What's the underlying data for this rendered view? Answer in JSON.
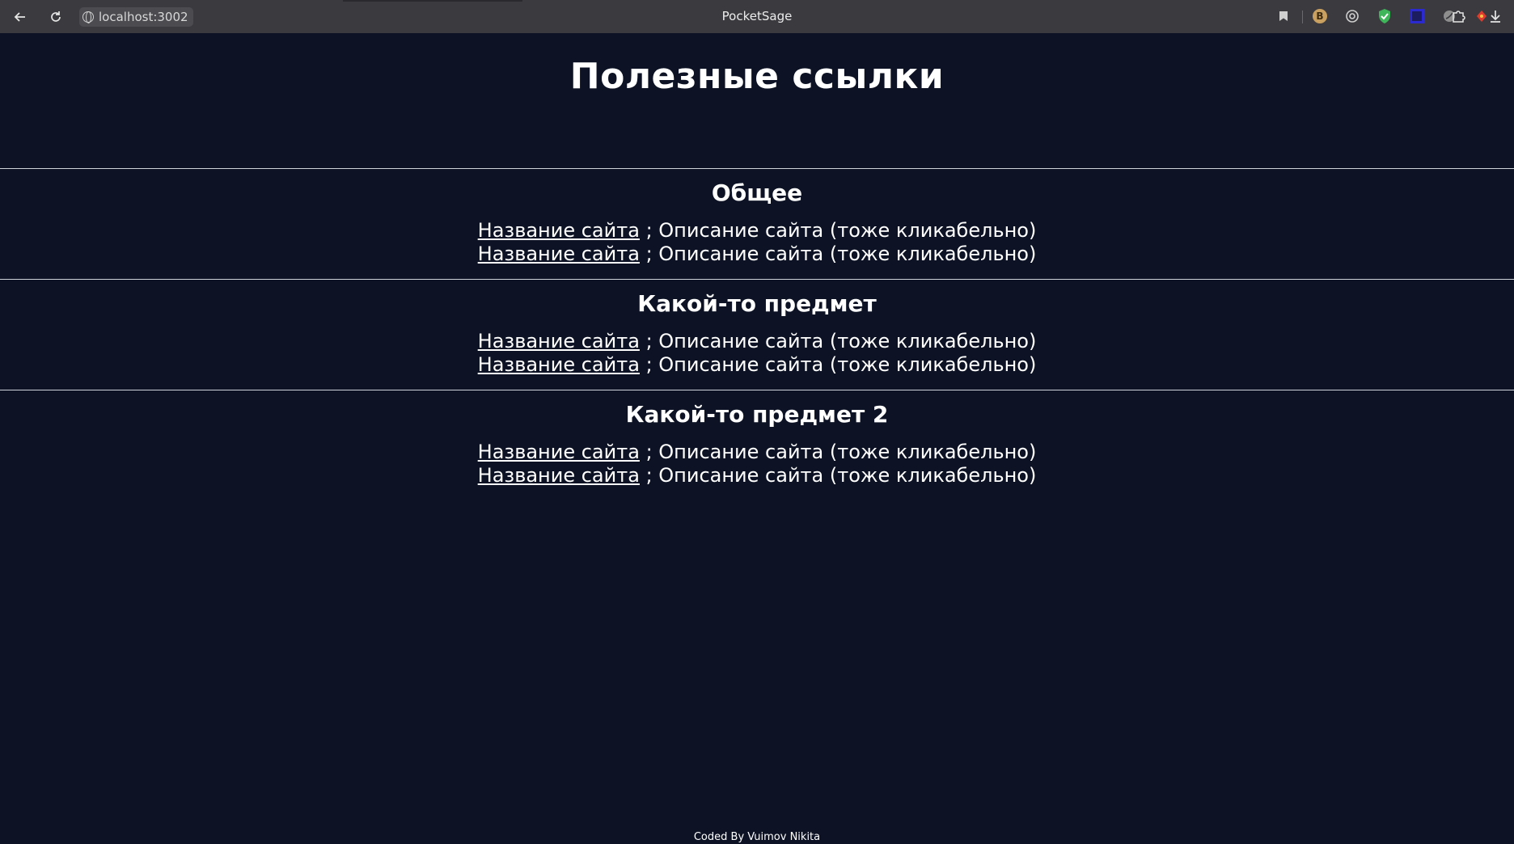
{
  "browser": {
    "url": "localhost:3002",
    "window_title": "PocketSage",
    "icons": [
      "back-arrow-icon",
      "reload-icon",
      "globe-icon",
      "bookmark-icon",
      "extension-b-icon",
      "at-sign-icon",
      "shield-check-icon",
      "square-ext-icon",
      "leaf-ext-icon",
      "red-ext-icon",
      "puzzle-icon",
      "download-icon"
    ],
    "ext_b_label": "B",
    "colors": {
      "chrome_bg": "#3b3b3f",
      "page_bg": "#0d1324"
    }
  },
  "page": {
    "title": "Полезные ссылки",
    "sections": [
      {
        "heading": "Общее",
        "links": [
          {
            "name": "Название сайта",
            "description": "; Описание сайта (тоже кликабельно)"
          },
          {
            "name": "Название сайта",
            "description": "; Описание сайта (тоже кликабельно)"
          }
        ]
      },
      {
        "heading": "Какой-то предмет",
        "links": [
          {
            "name": "Название сайта",
            "description": "; Описание сайта (тоже кликабельно)"
          },
          {
            "name": "Название сайта",
            "description": "; Описание сайта (тоже кликабельно)"
          }
        ]
      },
      {
        "heading": "Какой-то предмет 2",
        "links": [
          {
            "name": "Название сайта",
            "description": "; Описание сайта (тоже кликабельно)"
          },
          {
            "name": "Название сайта",
            "description": "; Описание сайта (тоже кликабельно)"
          }
        ]
      }
    ],
    "footer": "Coded By Vuimov Nikita"
  }
}
